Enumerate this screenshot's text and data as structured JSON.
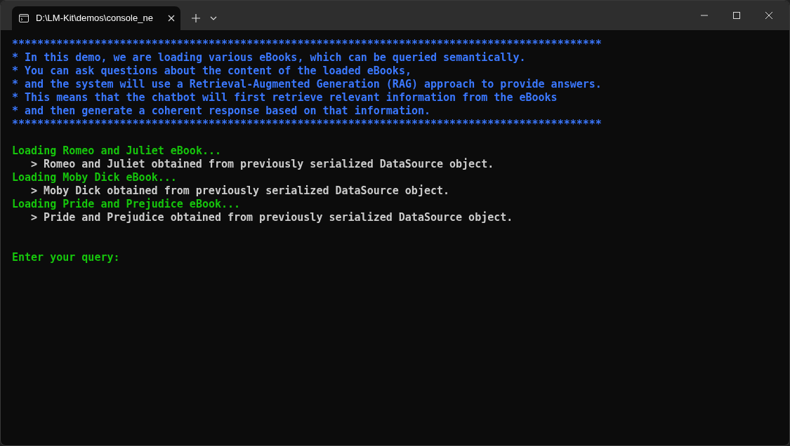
{
  "window": {
    "tab_title": "D:\\LM-Kit\\demos\\console_ne",
    "tab_selected": true
  },
  "console": {
    "banner": [
      "*********************************************************************************************",
      "* In this demo, we are loading various eBooks, which can be queried semantically.",
      "* You can ask questions about the content of the loaded eBooks,",
      "* and the system will use a Retrieval-Augmented Generation (RAG) approach to provide answers.",
      "* This means that the chatbot will first retrieve relevant information from the eBooks",
      "* and then generate a coherent response based on that information.",
      "*********************************************************************************************"
    ],
    "log": [
      {
        "kind": "status",
        "text": "Loading Romeo and Juliet eBook..."
      },
      {
        "kind": "detail",
        "text": "> Romeo and Juliet obtained from previously serialized DataSource object."
      },
      {
        "kind": "status",
        "text": "Loading Moby Dick eBook..."
      },
      {
        "kind": "detail",
        "text": "> Moby Dick obtained from previously serialized DataSource object."
      },
      {
        "kind": "status",
        "text": "Loading Pride and Prejudice eBook..."
      },
      {
        "kind": "detail",
        "text": "> Pride and Prejudice obtained from previously serialized DataSource object."
      }
    ],
    "prompt": "Enter your query:"
  }
}
